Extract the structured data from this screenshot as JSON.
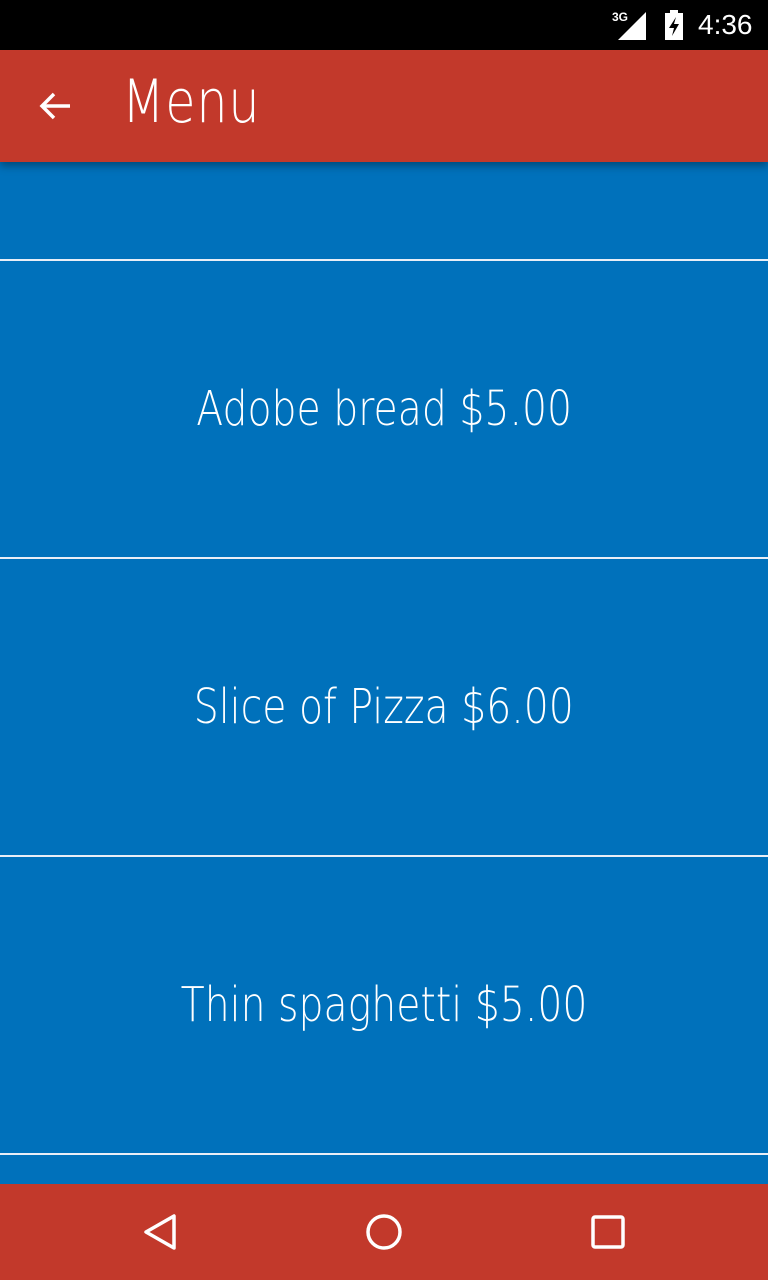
{
  "status_bar": {
    "network": "3G",
    "time": "4:36",
    "icons": [
      "signal-icon",
      "battery-charging-icon"
    ]
  },
  "app_bar": {
    "title": "Menu",
    "back_icon": "arrow-back-icon",
    "color": "#c2392b"
  },
  "menu": {
    "background": "#0071bb",
    "items": [
      {
        "label": "Adobe bread $5.00"
      },
      {
        "label": "Slice of Pizza $6.00"
      },
      {
        "label": "Thin spaghetti $5.00"
      }
    ]
  },
  "nav_bar": {
    "buttons": [
      "back-triangle-icon",
      "home-circle-icon",
      "recents-square-icon"
    ]
  }
}
